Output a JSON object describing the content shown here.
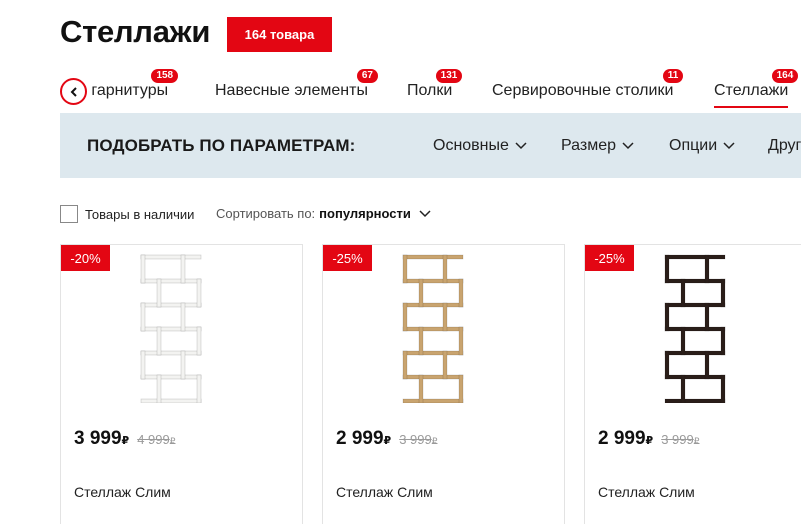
{
  "page": {
    "title": "Стеллажи",
    "count_badge": "164 товара"
  },
  "tabs": [
    {
      "label": "е гарнитуры",
      "count": "158"
    },
    {
      "label": "Навесные элементы",
      "count": "67"
    },
    {
      "label": "Полки",
      "count": "131"
    },
    {
      "label": "Сервировочные столики",
      "count": "11"
    },
    {
      "label": "Стеллажи",
      "count": "164",
      "active": true
    }
  ],
  "filters": {
    "title": "ПОДОБРАТЬ ПО ПАРАМЕТРАМ:",
    "items": [
      "Основные",
      "Размер",
      "Опции",
      "Друг"
    ]
  },
  "stock_filter": {
    "label": "Товары в наличии",
    "checked": false
  },
  "sort": {
    "label": "Сортировать по:",
    "value": "популярности"
  },
  "products": [
    {
      "discount": "-20%",
      "price": "3 999",
      "currency": "₽",
      "old_price": "4 999",
      "name": "Стеллаж Слим",
      "color": "#f3f3f1"
    },
    {
      "discount": "-25%",
      "price": "2 999",
      "currency": "₽",
      "old_price": "3 999",
      "name": "Стеллаж Слим",
      "color": "#c9a46f"
    },
    {
      "discount": "-25%",
      "price": "2 999",
      "currency": "₽",
      "old_price": "3 999",
      "name": "Стеллаж Слим",
      "color": "#2a1e19"
    }
  ],
  "colors": {
    "accent": "#e30613",
    "filter_bar": "#dde8ee"
  }
}
